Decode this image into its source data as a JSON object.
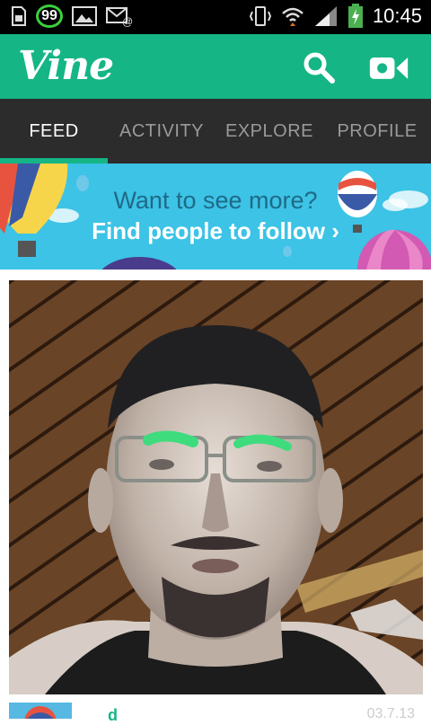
{
  "status_bar": {
    "notification_count": "99",
    "time": "10:45"
  },
  "app_bar": {
    "logo": "Vine",
    "icons": [
      "search-icon",
      "video-camera-icon"
    ],
    "accent_color": "#15b585"
  },
  "tabs": [
    {
      "label": "FEED",
      "active": true
    },
    {
      "label": "ACTIVITY",
      "active": false
    },
    {
      "label": "EXPLORE",
      "active": false
    },
    {
      "label": "PROFILE",
      "active": false
    }
  ],
  "banner": {
    "line1": "Want to see more?",
    "line2": "Find people to follow",
    "chevron": "›"
  },
  "post": {
    "date_partial": "03.7.13"
  }
}
